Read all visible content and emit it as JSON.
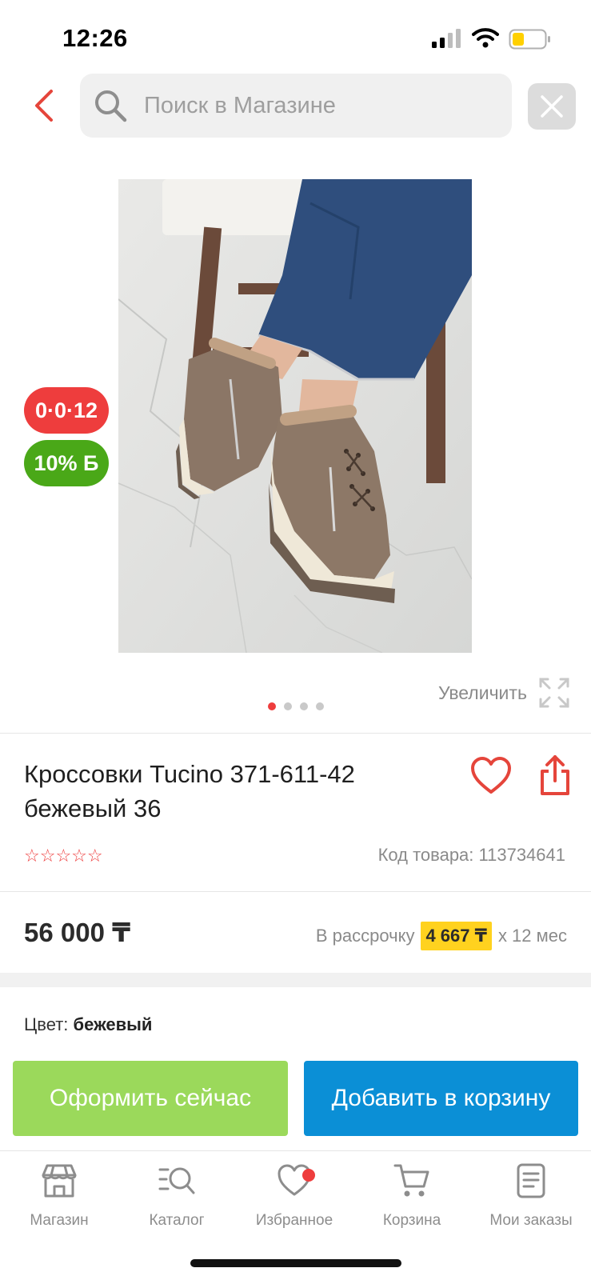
{
  "status_bar": {
    "time": "12:26"
  },
  "search": {
    "placeholder": "Поиск в Магазине"
  },
  "gallery": {
    "badges": [
      "0·0·12",
      "10% Б"
    ],
    "zoom_label": "Увеличить",
    "slide_count": 4,
    "active_slide": 1
  },
  "product": {
    "title_line1": "Кроссовки Tucino 371-611-42",
    "title_line2": "бежевый 36",
    "rating_stars": "☆☆☆☆☆",
    "sku_text": "Код товара: 113734641",
    "price": "56 000 ₸",
    "installment_prefix": "В рассрочку",
    "installment_amount": "4 667 ₸",
    "installment_suffix": "x 12 мес",
    "color_label": "Цвет:",
    "color_value": "бежевый"
  },
  "actions": {
    "checkout": "Оформить сейчас",
    "add_to_cart": "Добавить в корзину"
  },
  "tabs": [
    {
      "label": "Магазин",
      "icon": "store-icon"
    },
    {
      "label": "Каталог",
      "icon": "catalog-search-icon"
    },
    {
      "label": "Избранное",
      "icon": "heart-icon",
      "has_notification": true
    },
    {
      "label": "Корзина",
      "icon": "cart-icon"
    },
    {
      "label": "Мои заказы",
      "icon": "orders-list-icon"
    }
  ],
  "colors": {
    "accent_red": "#ee3d3d",
    "installment_highlight": "#ffd21f",
    "checkout_green": "#9bd95b",
    "cart_blue": "#0b8fd6",
    "bonus_green": "#4aa818"
  }
}
